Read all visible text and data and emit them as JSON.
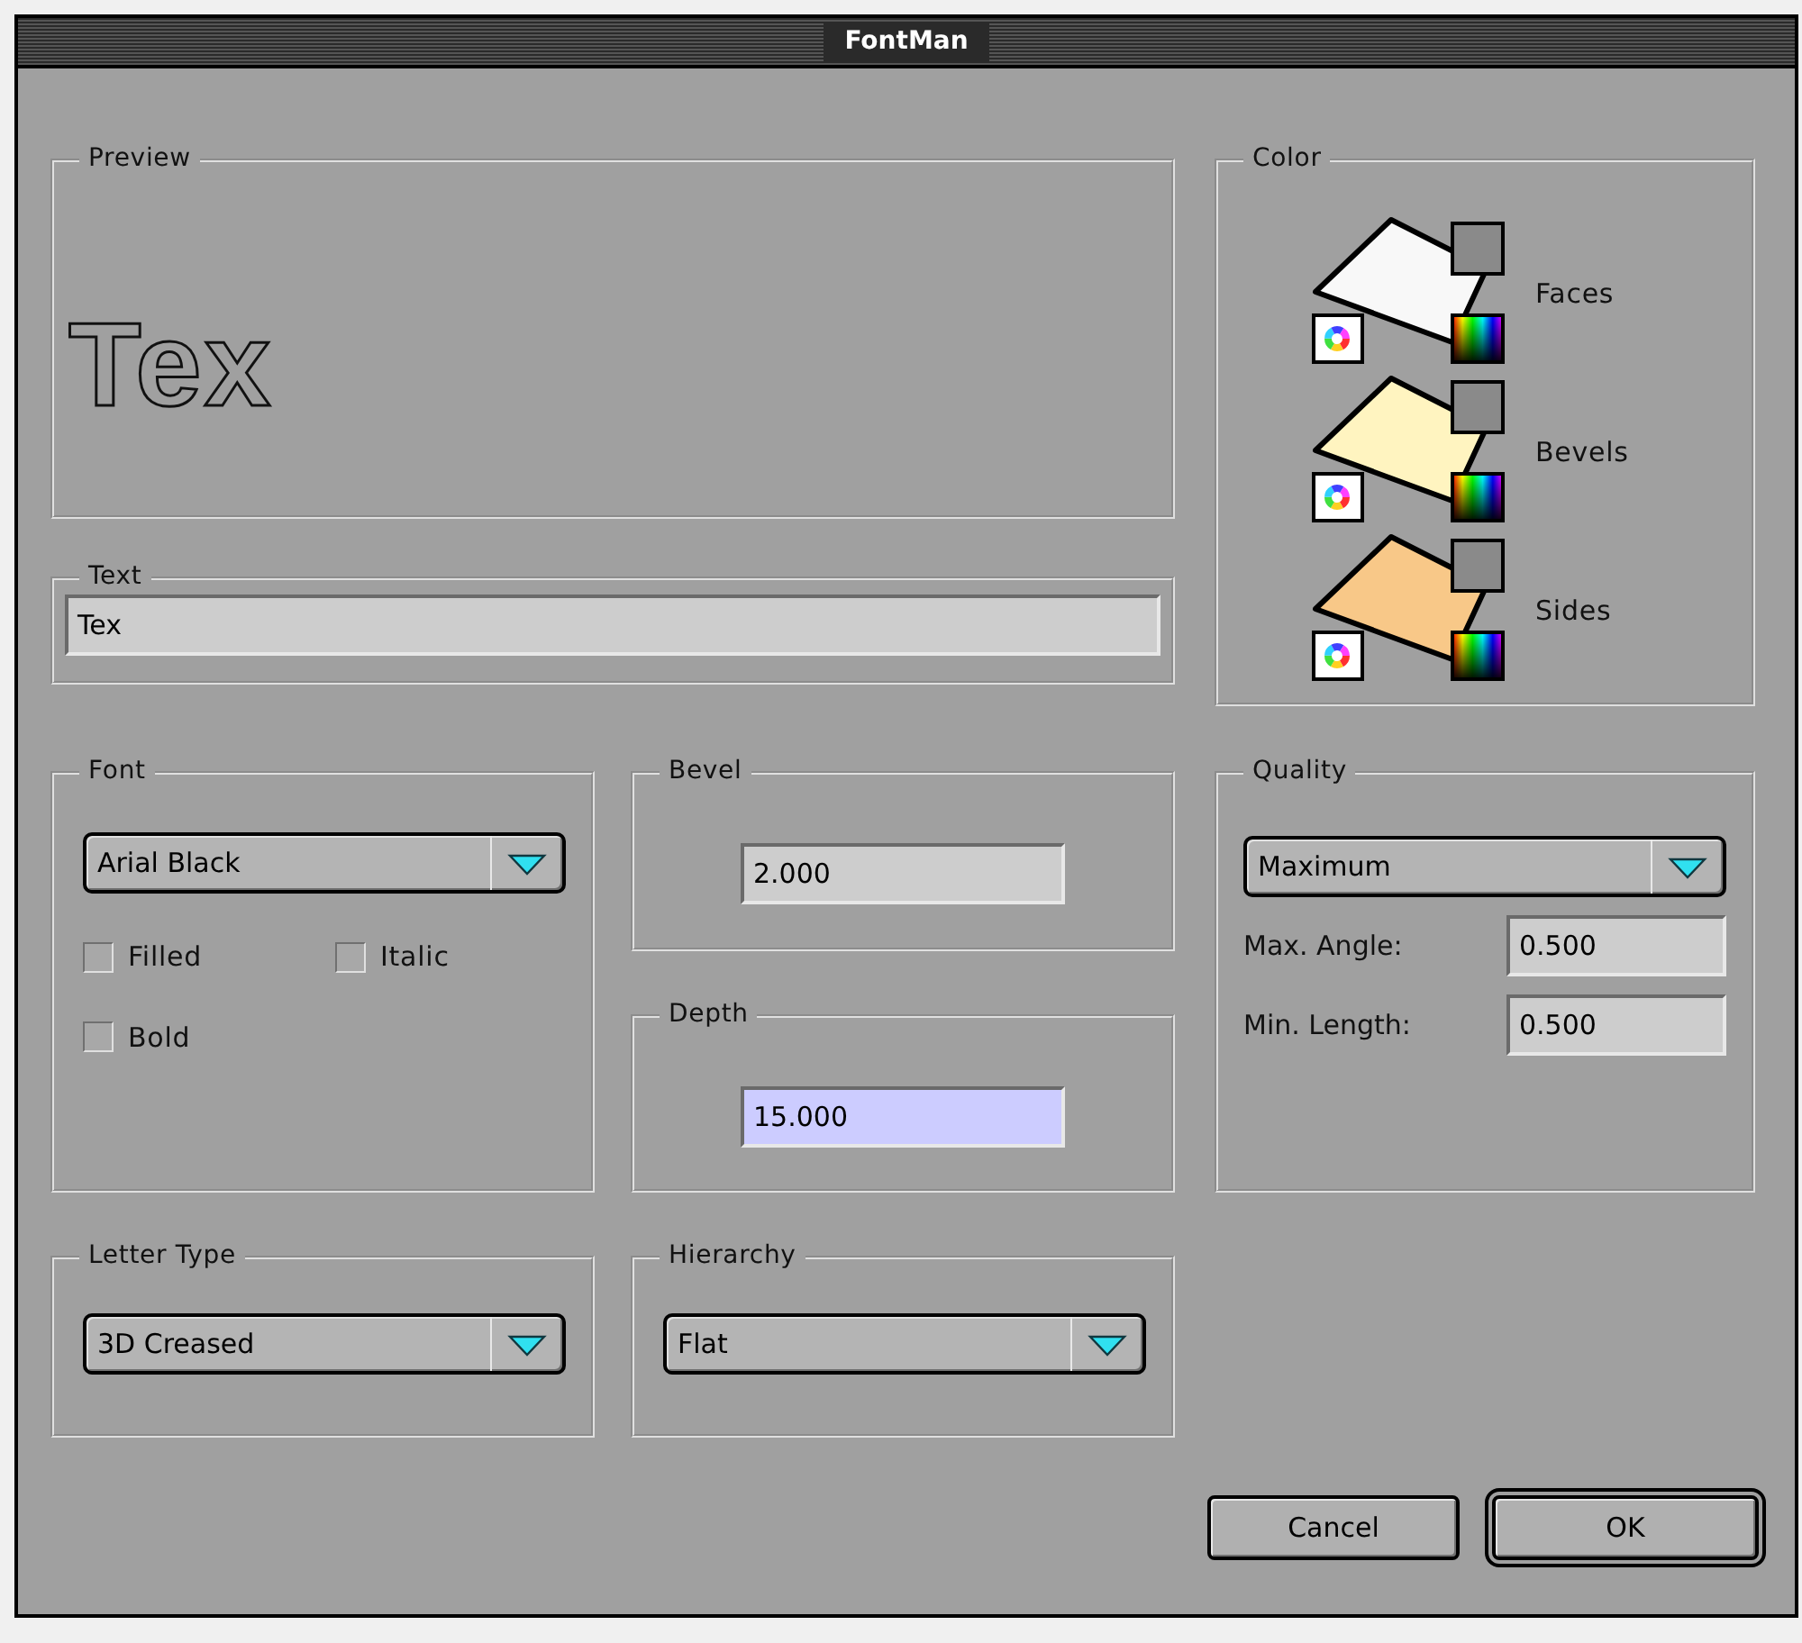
{
  "window": {
    "title": "FontMan"
  },
  "preview": {
    "label": "Preview",
    "text": "Tex"
  },
  "text_group": {
    "label": "Text",
    "field": {
      "value": "Tex",
      "focused": false
    }
  },
  "color": {
    "label": "Color",
    "items": [
      {
        "name": "Faces",
        "color": "#f8f8f8"
      },
      {
        "name": "Bevels",
        "color": "#fff4c0"
      },
      {
        "name": "Sides",
        "color": "#f8c888"
      }
    ]
  },
  "font": {
    "label": "Font",
    "dropdown": "Arial Black",
    "checkboxes": [
      {
        "label": "Filled",
        "checked": false
      },
      {
        "label": "Italic",
        "checked": false
      },
      {
        "label": "Bold",
        "checked": false
      }
    ]
  },
  "bevel": {
    "label": "Bevel",
    "field": {
      "value": "2.000",
      "focused": false
    }
  },
  "depth": {
    "label": "Depth",
    "field": {
      "value": "15.000",
      "focused": true
    }
  },
  "quality": {
    "label": "Quality",
    "dropdown": "Maximum",
    "fields": [
      {
        "label": "Max. Angle:",
        "value": "0.500",
        "focused": false
      },
      {
        "label": "Min. Length:",
        "value": "0.500",
        "focused": false
      }
    ]
  },
  "letter_type": {
    "label": "Letter Type",
    "dropdown": "3D Creased"
  },
  "hierarchy": {
    "label": "Hierarchy",
    "dropdown": "Flat"
  },
  "buttons": [
    {
      "label": "Cancel",
      "default": false
    },
    {
      "label": "OK",
      "default": true
    }
  ]
}
